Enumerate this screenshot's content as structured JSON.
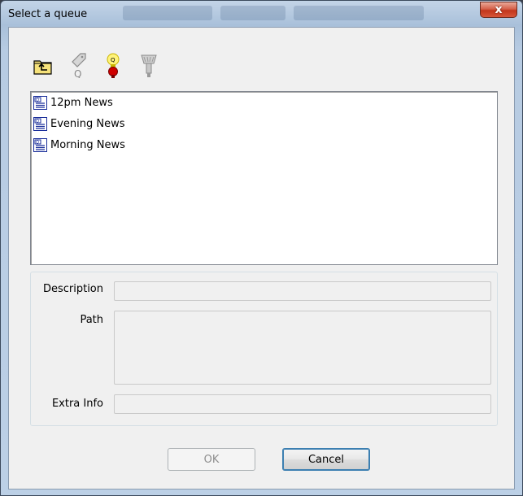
{
  "window": {
    "title": "Select a queue",
    "close_label": "x"
  },
  "toolbar": {
    "buttons": [
      {
        "icon": "folder-up-icon",
        "enabled": true
      },
      {
        "icon": "queue-tag-icon",
        "enabled": false
      },
      {
        "icon": "queue-bulb-icon",
        "enabled": true
      },
      {
        "icon": "shower-icon",
        "enabled": false
      }
    ]
  },
  "queues": [
    {
      "label": "12pm News"
    },
    {
      "label": "Evening News"
    },
    {
      "label": "Morning News"
    }
  ],
  "details": {
    "description_label": "Description",
    "description_value": "",
    "path_label": "Path",
    "path_value": "",
    "extra_label": "Extra Info",
    "extra_value": ""
  },
  "buttons": {
    "ok_label": "OK",
    "cancel_label": "Cancel"
  },
  "colors": {
    "accent": "#3c7fb1",
    "close": "#c2351b"
  }
}
